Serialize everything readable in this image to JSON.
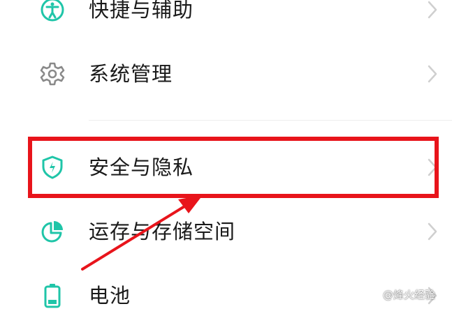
{
  "colors": {
    "accent": "#1fc5a8",
    "gray_icon": "#8a8a8a",
    "highlight": "#e8141b",
    "chevron": "#cfcfcf"
  },
  "settings_list": {
    "items": [
      {
        "label": "快捷与辅助",
        "icon": "accessibility-icon"
      },
      {
        "label": "系统管理",
        "icon": "gear-icon"
      },
      {
        "label": "安全与隐私",
        "icon": "shield-icon"
      },
      {
        "label": "运存与存储空间",
        "icon": "pie-chart-icon"
      },
      {
        "label": "电池",
        "icon": "battery-icon"
      }
    ]
  },
  "annotation": {
    "highlighted_item": "安全与隐私",
    "arrow": "red-pointer-arrow"
  },
  "watermark": {
    "text": "@烽火经验",
    "icon": "flower-logo-icon"
  }
}
